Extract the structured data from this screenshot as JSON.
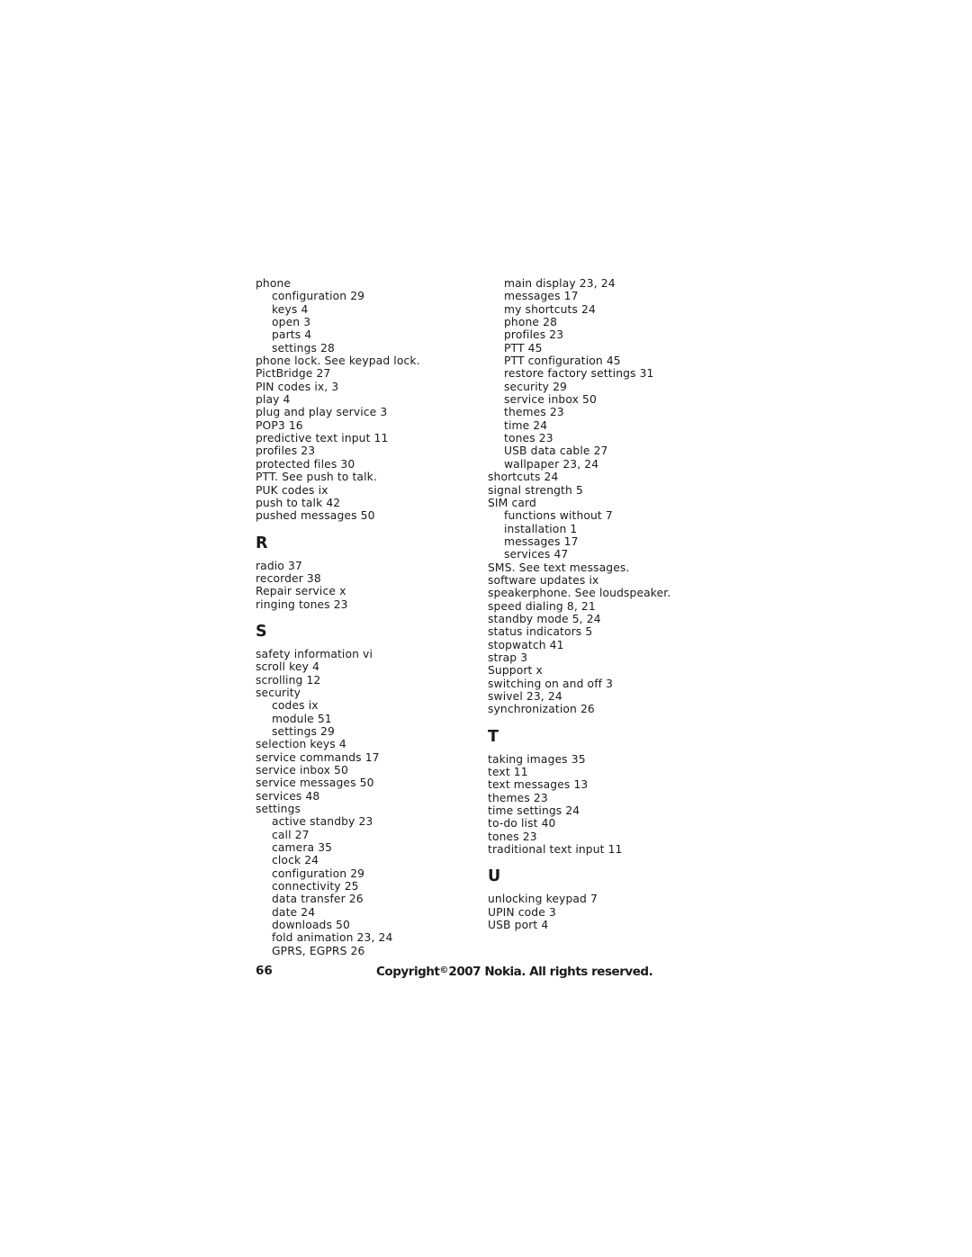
{
  "document": {
    "type": "index-page",
    "page_number": "66",
    "copyright": {
      "prefix": "Copyright",
      "symbol": "©",
      "suffix": "2007 Nokia. All rights reserved."
    }
  },
  "columns": {
    "left": [
      {
        "kind": "entry",
        "level": 0,
        "text": "phone"
      },
      {
        "kind": "entry",
        "level": 1,
        "text": "configuration 29"
      },
      {
        "kind": "entry",
        "level": 1,
        "text": "keys 4"
      },
      {
        "kind": "entry",
        "level": 1,
        "text": "open 3"
      },
      {
        "kind": "entry",
        "level": 1,
        "text": "parts 4"
      },
      {
        "kind": "entry",
        "level": 1,
        "text": "settings 28"
      },
      {
        "kind": "entry",
        "level": 0,
        "text": "phone lock. See keypad lock."
      },
      {
        "kind": "entry",
        "level": 0,
        "text": "PictBridge 27"
      },
      {
        "kind": "entry",
        "level": 0,
        "text": "PIN codes ix, 3"
      },
      {
        "kind": "entry",
        "level": 0,
        "text": "play 4"
      },
      {
        "kind": "entry",
        "level": 0,
        "text": "plug and play service 3"
      },
      {
        "kind": "entry",
        "level": 0,
        "text": "POP3 16"
      },
      {
        "kind": "entry",
        "level": 0,
        "text": "predictive text input 11"
      },
      {
        "kind": "entry",
        "level": 0,
        "text": "profiles 23"
      },
      {
        "kind": "entry",
        "level": 0,
        "text": "protected files 30"
      },
      {
        "kind": "entry",
        "level": 0,
        "text": "PTT. See push to talk."
      },
      {
        "kind": "entry",
        "level": 0,
        "text": "PUK codes ix"
      },
      {
        "kind": "entry",
        "level": 0,
        "text": "push to talk 42"
      },
      {
        "kind": "entry",
        "level": 0,
        "text": "pushed messages 50"
      },
      {
        "kind": "letter",
        "text": "R"
      },
      {
        "kind": "entry",
        "level": 0,
        "text": "radio 37"
      },
      {
        "kind": "entry",
        "level": 0,
        "text": "recorder 38"
      },
      {
        "kind": "entry",
        "level": 0,
        "text": "Repair service x"
      },
      {
        "kind": "entry",
        "level": 0,
        "text": "ringing tones 23"
      },
      {
        "kind": "letter",
        "text": "S"
      },
      {
        "kind": "entry",
        "level": 0,
        "text": "safety information vi"
      },
      {
        "kind": "entry",
        "level": 0,
        "text": "scroll key 4"
      },
      {
        "kind": "entry",
        "level": 0,
        "text": "scrolling 12"
      },
      {
        "kind": "entry",
        "level": 0,
        "text": "security"
      },
      {
        "kind": "entry",
        "level": 1,
        "text": "codes ix"
      },
      {
        "kind": "entry",
        "level": 1,
        "text": "module 51"
      },
      {
        "kind": "entry",
        "level": 1,
        "text": "settings 29"
      },
      {
        "kind": "entry",
        "level": 0,
        "text": "selection keys 4"
      },
      {
        "kind": "entry",
        "level": 0,
        "text": "service commands 17"
      },
      {
        "kind": "entry",
        "level": 0,
        "text": "service inbox 50"
      },
      {
        "kind": "entry",
        "level": 0,
        "text": "service messages 50"
      },
      {
        "kind": "entry",
        "level": 0,
        "text": "services 48"
      },
      {
        "kind": "entry",
        "level": 0,
        "text": "settings"
      },
      {
        "kind": "entry",
        "level": 1,
        "text": "active standby 23"
      },
      {
        "kind": "entry",
        "level": 1,
        "text": "call 27"
      },
      {
        "kind": "entry",
        "level": 1,
        "text": "camera 35"
      },
      {
        "kind": "entry",
        "level": 1,
        "text": "clock 24"
      },
      {
        "kind": "entry",
        "level": 1,
        "text": "configuration 29"
      },
      {
        "kind": "entry",
        "level": 1,
        "text": "connectivity 25"
      },
      {
        "kind": "entry",
        "level": 1,
        "text": "data transfer 26"
      },
      {
        "kind": "entry",
        "level": 1,
        "text": "date 24"
      },
      {
        "kind": "entry",
        "level": 1,
        "text": "downloads 50"
      },
      {
        "kind": "entry",
        "level": 1,
        "text": "fold animation 23, 24"
      },
      {
        "kind": "entry",
        "level": 1,
        "text": "GPRS, EGPRS 26"
      }
    ],
    "right": [
      {
        "kind": "entry",
        "level": 1,
        "text": "main display 23, 24"
      },
      {
        "kind": "entry",
        "level": 1,
        "text": "messages 17"
      },
      {
        "kind": "entry",
        "level": 1,
        "text": "my shortcuts 24"
      },
      {
        "kind": "entry",
        "level": 1,
        "text": "phone 28"
      },
      {
        "kind": "entry",
        "level": 1,
        "text": "profiles 23"
      },
      {
        "kind": "entry",
        "level": 1,
        "text": "PTT 45"
      },
      {
        "kind": "entry",
        "level": 1,
        "text": "PTT configuration 45"
      },
      {
        "kind": "entry",
        "level": 1,
        "text": "restore factory settings 31"
      },
      {
        "kind": "entry",
        "level": 1,
        "text": "security 29"
      },
      {
        "kind": "entry",
        "level": 1,
        "text": "service inbox 50"
      },
      {
        "kind": "entry",
        "level": 1,
        "text": "themes 23"
      },
      {
        "kind": "entry",
        "level": 1,
        "text": "time 24"
      },
      {
        "kind": "entry",
        "level": 1,
        "text": "tones 23"
      },
      {
        "kind": "entry",
        "level": 1,
        "text": "USB data cable 27"
      },
      {
        "kind": "entry",
        "level": 1,
        "text": "wallpaper 23, 24"
      },
      {
        "kind": "entry",
        "level": 0,
        "text": "shortcuts 24"
      },
      {
        "kind": "entry",
        "level": 0,
        "text": "signal strength 5"
      },
      {
        "kind": "entry",
        "level": 0,
        "text": "SIM card"
      },
      {
        "kind": "entry",
        "level": 1,
        "text": "functions without 7"
      },
      {
        "kind": "entry",
        "level": 1,
        "text": "installation 1"
      },
      {
        "kind": "entry",
        "level": 1,
        "text": "messages 17"
      },
      {
        "kind": "entry",
        "level": 1,
        "text": "services 47"
      },
      {
        "kind": "entry",
        "level": 0,
        "text": "SMS. See text messages."
      },
      {
        "kind": "entry",
        "level": 0,
        "text": "software updates ix"
      },
      {
        "kind": "entry",
        "level": 0,
        "text": "speakerphone. See loudspeaker."
      },
      {
        "kind": "entry",
        "level": 0,
        "text": "speed dialing 8, 21"
      },
      {
        "kind": "entry",
        "level": 0,
        "text": "standby mode 5, 24"
      },
      {
        "kind": "entry",
        "level": 0,
        "text": "status indicators 5"
      },
      {
        "kind": "entry",
        "level": 0,
        "text": "stopwatch 41"
      },
      {
        "kind": "entry",
        "level": 0,
        "text": "strap 3"
      },
      {
        "kind": "entry",
        "level": 0,
        "text": "Support x"
      },
      {
        "kind": "entry",
        "level": 0,
        "text": "switching on and off 3"
      },
      {
        "kind": "entry",
        "level": 0,
        "text": "swivel 23, 24"
      },
      {
        "kind": "entry",
        "level": 0,
        "text": "synchronization 26"
      },
      {
        "kind": "letter",
        "text": "T"
      },
      {
        "kind": "entry",
        "level": 0,
        "text": "taking images 35"
      },
      {
        "kind": "entry",
        "level": 0,
        "text": "text 11"
      },
      {
        "kind": "entry",
        "level": 0,
        "text": "text messages 13"
      },
      {
        "kind": "entry",
        "level": 0,
        "text": "themes 23"
      },
      {
        "kind": "entry",
        "level": 0,
        "text": "time settings 24"
      },
      {
        "kind": "entry",
        "level": 0,
        "text": "to-do list 40"
      },
      {
        "kind": "entry",
        "level": 0,
        "text": "tones 23"
      },
      {
        "kind": "entry",
        "level": 0,
        "text": "traditional text input 11"
      },
      {
        "kind": "letter",
        "text": "U"
      },
      {
        "kind": "entry",
        "level": 0,
        "text": "unlocking keypad 7"
      },
      {
        "kind": "entry",
        "level": 0,
        "text": "UPIN code 3"
      },
      {
        "kind": "entry",
        "level": 0,
        "text": "USB port 4"
      }
    ]
  }
}
